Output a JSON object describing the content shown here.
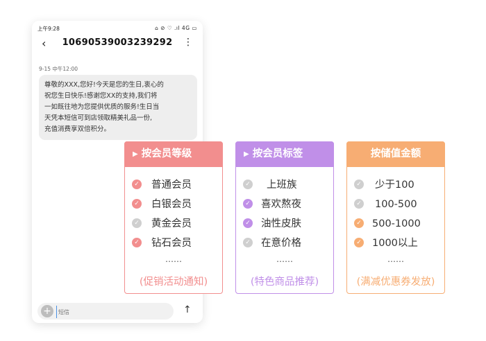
{
  "phone": {
    "status_time": "上午9:28",
    "status_icons": "⌂ ⊘ ♡ .ıl 4G ▭",
    "sender": "10690539003239292",
    "date": "9-15 中午12:00",
    "message_lines": [
      "尊敬的XXX,您好!今天是您的生日,衷心的",
      "祝您生日快乐!感谢您XX的支持,我们将",
      "一如既往地为您提供优质的服务!生日当",
      "天凭本短信可到店领取精美礼品一份,",
      "充值消费享双倍积分。"
    ],
    "composer_placeholder": "短信"
  },
  "cards": [
    {
      "title": "按会员等级",
      "color": "#f28e8e",
      "items": [
        "普通会员",
        "白银会员",
        "黄金会员",
        "钻石会员"
      ],
      "checked": [
        true,
        true,
        false,
        true
      ],
      "dots": "……",
      "note": "(促销活动通知)"
    },
    {
      "title": "按会员标签",
      "color": "#c08fe8",
      "items": [
        "上班族",
        "喜欢熬夜",
        "油性皮肤",
        "在意价格"
      ],
      "checked": [
        false,
        true,
        true,
        false
      ],
      "dots": "……",
      "note": "(特色商品推荐)"
    },
    {
      "title": "按储值金额",
      "color": "#f7ad73",
      "items": [
        "少于100",
        "100-500",
        "500-1000",
        "1000以上"
      ],
      "checked": [
        false,
        false,
        true,
        true
      ],
      "dots": "……",
      "note": "(满减优惠券发放)"
    }
  ]
}
